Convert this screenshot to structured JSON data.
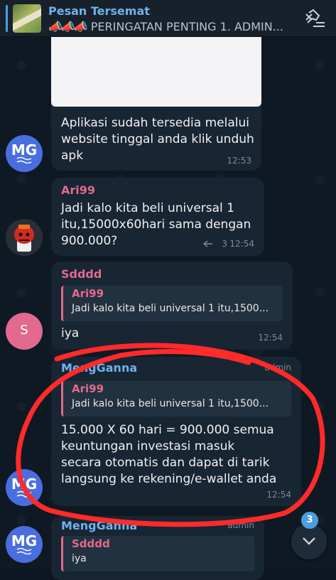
{
  "pinned": {
    "title": "Pesan Tersemat",
    "megaphones": "📣📣📣",
    "subtitle": "PERINGATAN PENTING  1. ADMIN..."
  },
  "messages": [
    {
      "text": "Aplikasi sudah tersedia melalui\nwebsite tinggal anda klik unduh\napk",
      "time": "12:53",
      "avatar": "MG"
    },
    {
      "sender": "Ari99",
      "text": "Jadi kalo kita beli universal 1\nitu,15000x60hari sama dengan\n900.000?",
      "replies": "3",
      "time": "12:54"
    },
    {
      "sender": "Sdddd",
      "quote_name": "Ari99",
      "quote_text": "Jadi kalo kita beli universal 1 itu,1500...",
      "text": "iya",
      "time": "12:54",
      "avatar": "S"
    },
    {
      "sender": "MengGanna",
      "sender_role": "admin",
      "quote_name": "Ari99",
      "quote_text": "Jadi kalo kita beli universal 1 itu,1500...",
      "text": "15.000 X 60 hari = 900.000 semua\nkeuntungan investasi masuk\nsecara otomatis dan dapat di tarik\nlangsung ke rekening/e-wallet anda",
      "time": "12:54",
      "avatar": "MG"
    },
    {
      "sender": "MengGanna",
      "sender_role": "admin",
      "quote_name": "Sdddd",
      "quote_text": "iya",
      "avatar": "MG"
    }
  ],
  "scroll": {
    "unread": "3"
  },
  "colors": {
    "background": "#0e1621",
    "bubble": "#182533",
    "accent": "#4a9fe0",
    "pink": "#e26a8e",
    "green_name": "#6fcf7f",
    "blue_name": "#6fb3ec",
    "annotation": "#ff2a2a"
  }
}
